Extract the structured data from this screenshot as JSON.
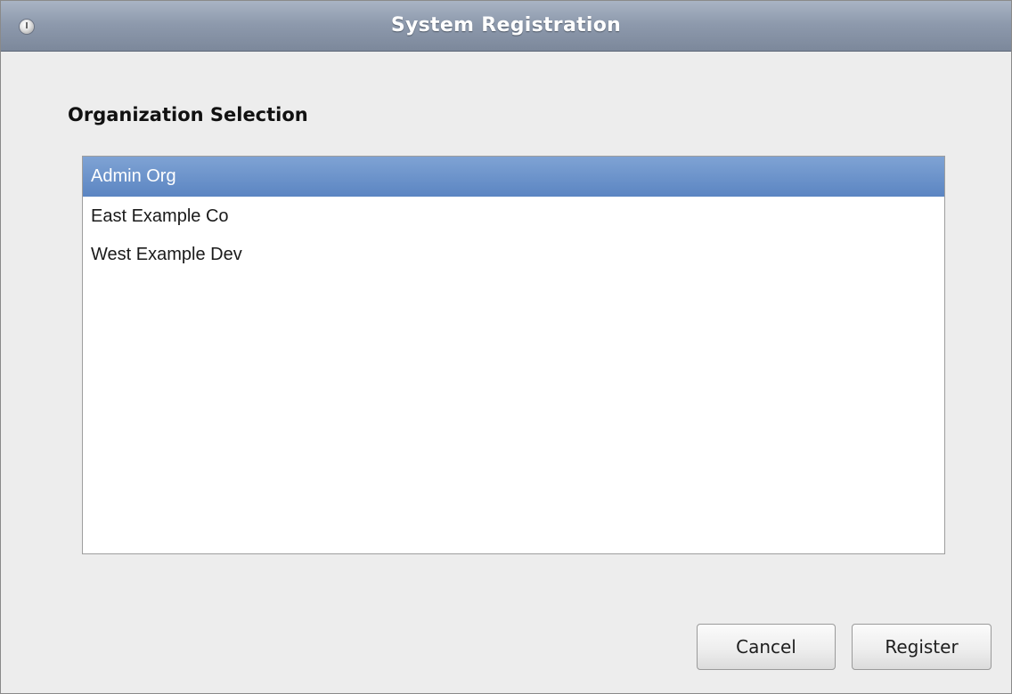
{
  "window": {
    "title": "System Registration"
  },
  "section": {
    "heading": "Organization Selection"
  },
  "organizations": {
    "items": [
      {
        "label": "Admin Org",
        "selected": true
      },
      {
        "label": "East Example Co",
        "selected": false
      },
      {
        "label": "West Example Dev",
        "selected": false
      }
    ]
  },
  "buttons": {
    "cancel_label": "Cancel",
    "register_label": "Register"
  },
  "colors": {
    "titlebar": "#8e9aad",
    "selection": "#6b93cb",
    "window_bg": "#ededed"
  },
  "icons": {
    "title_icon": "power-icon"
  }
}
